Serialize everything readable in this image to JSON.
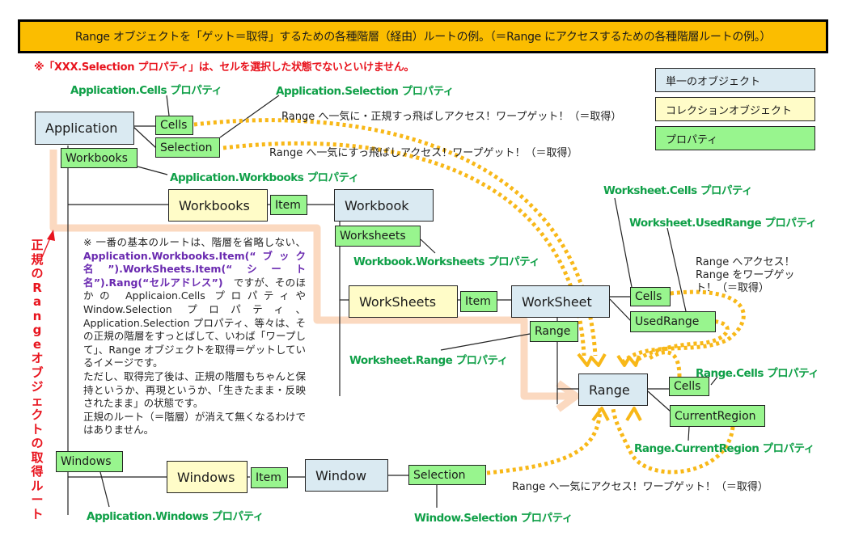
{
  "banner": {
    "title": "Range オブジェクトを「ゲット＝取得」するための各種階層（経由）ルートの例。（＝Range にアクセスするための各種階層ルートの例。）"
  },
  "warning": "※「XXX.Selection プロパティ」は、セルを選択した状態でないといけません。",
  "legend": [
    {
      "label": "単一のオブジェクト",
      "color": "#daeaf2"
    },
    {
      "label": "コレクションオブジェクト",
      "color": "#fffcc8"
    },
    {
      "label": "プロパティ",
      "color": "#98f58e"
    }
  ],
  "objects": {
    "application": "Application",
    "workbooks_col": "Workbooks",
    "workbook": "Workbook",
    "worksheets_col": "WorkSheets",
    "worksheet": "WorkSheet",
    "range": "Range",
    "windows_col": "Windows",
    "window": "Window"
  },
  "properties": {
    "app_cells": "Cells",
    "app_selection": "Selection",
    "app_workbooks": "Workbooks",
    "workbooks_item": "Item",
    "wb_worksheets": "Worksheets",
    "worksheets_item": "Item",
    "ws_cells": "Cells",
    "ws_usedrange": "UsedRange",
    "ws_range": "Range",
    "range_cells": "Cells",
    "range_currentregion": "CurrentRegion",
    "app_windows": "Windows",
    "windows_item": "Item",
    "win_selection": "Selection"
  },
  "property_labels": {
    "app_cells": "Application.Cells プロパティ",
    "app_selection": "Application.Selection プロパティ",
    "app_workbooks": "Application.Workbooks プロパティ",
    "wb_worksheets": "Workbook.Worksheets プロパティ",
    "ws_cells": "Worksheet.Cells プロパティ",
    "ws_usedrange": "Worksheet.UsedRange プロパティ",
    "ws_range": "Worksheet.Range プロパティ",
    "range_cells": "Range.Cells プロパティ",
    "range_currentregion": "Range.CurrentRegion プロパティ",
    "app_windows": "Application.Windows プロパティ",
    "win_selection": "Window.Selection プロパティ"
  },
  "notes": {
    "cells_warp": "Range へ一気に・正規すっ飛ばしアクセス！ワープゲット！（＝取得）",
    "selection_warp": "Range へ一気にすっ飛ばしアクセス！ワープゲット！（＝取得）",
    "ws_warp_1": "Range へアクセス！",
    "ws_warp_2": "Range をワープゲッ",
    "ws_warp_3": "ト！（＝取得）",
    "window_warp": "Range へ一気にアクセス！ワープゲット！（＝取得）"
  },
  "description": {
    "p1_pre": "※ 一番の基本のルートは、階層を省略しない、",
    "p1_code": "Application.Workbooks.Item(“ブック名”).WorkSheets.Item(“シート名”).Rang(“セルアドレス”)",
    "p1_post": "　ですが、そのほかの Applicaion.Cells プロパティや Window.Selection プロパティ、Application.Selection プロパティ、等々は、その正規の階層をすっとばして、いわば「ワープして」、Range オブジェクトを取得＝ゲットしているイメージです。",
    "p2": "ただし、取得完了後は、正規の階層もちゃんと保持というか、再現というか、「生きたまま・反映されたまま」の状態です。",
    "p3": "正規のルート（＝階層）が消えて無くなるわけではありません。"
  },
  "vertical_label": "正規のRangeオブジェクトの取得ルート",
  "colors": {
    "banner": "#fbbd00",
    "warning": "#e8141e",
    "property_label": "#10a048",
    "warp_dots": "#f8b818",
    "route_arrow": "#fbd9c0"
  }
}
